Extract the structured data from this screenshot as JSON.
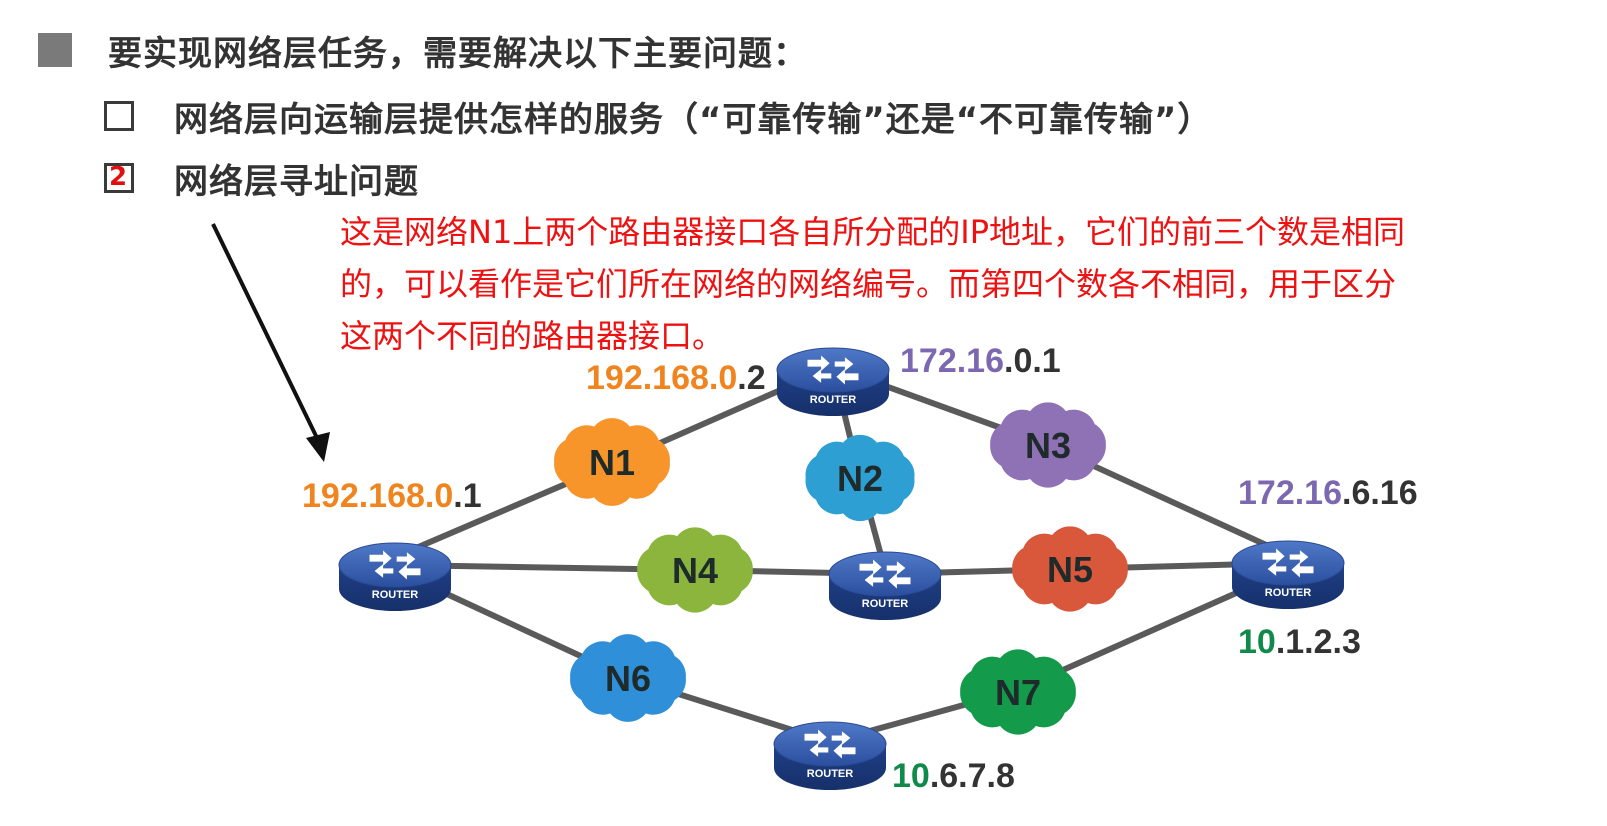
{
  "heading": {
    "text": "要实现网络层任务，需要解决以下主要问题："
  },
  "items": [
    {
      "text": "网络层向运输层提供怎样的服务（“可靠传输”还是“不可靠传输”）",
      "checked": false
    },
    {
      "text": "网络层寻址问题",
      "checked": true,
      "mark": "2"
    }
  ],
  "annotation": {
    "lines": [
      "这是网络N1上两个路由器接口各自所分配的IP地址，它们的前三个数是相同",
      "的，可以看作是它们所在网络的网络编号。而第四个数各不相同，用于区分",
      "这两个不同的路由器接口。"
    ],
    "color": "#ee1111"
  },
  "diagram": {
    "router_label": "ROUTER",
    "routers": [
      "R1",
      "R2",
      "R3",
      "R4",
      "R5"
    ],
    "networks": [
      {
        "name": "N1",
        "color": "#f7952b"
      },
      {
        "name": "N2",
        "color": "#2d9fd3"
      },
      {
        "name": "N3",
        "color": "#8f72b6"
      },
      {
        "name": "N4",
        "color": "#8bb53d"
      },
      {
        "name": "N5",
        "color": "#d9573a"
      },
      {
        "name": "N6",
        "color": "#2f8fd8"
      },
      {
        "name": "N7",
        "color": "#139a4a"
      }
    ],
    "addresses": [
      {
        "net": "192.168.0",
        "host": ".1",
        "net_parts": [
          "192",
          ".168",
          ".0"
        ],
        "color": "#f0841e"
      },
      {
        "net": "192.168.0",
        "host": ".2",
        "net_parts": [
          "192",
          ".168",
          ".0"
        ],
        "color": "#f0841e"
      },
      {
        "net": "172.16",
        "host": ".0.1",
        "net_parts": [
          "172",
          ".16"
        ],
        "color": "#7b68b0"
      },
      {
        "net": "172.16",
        "host": ".6.16",
        "net_parts": [
          "172",
          ".16"
        ],
        "color": "#7b68b0"
      },
      {
        "net": "10",
        "host": ".1.2.3",
        "net_parts": [
          "10"
        ],
        "color": "#0f8a4a"
      },
      {
        "net": "10",
        "host": ".6.7.8",
        "net_parts": [
          "10"
        ],
        "color": "#0f8a4a"
      }
    ],
    "host_color": "#333333"
  }
}
